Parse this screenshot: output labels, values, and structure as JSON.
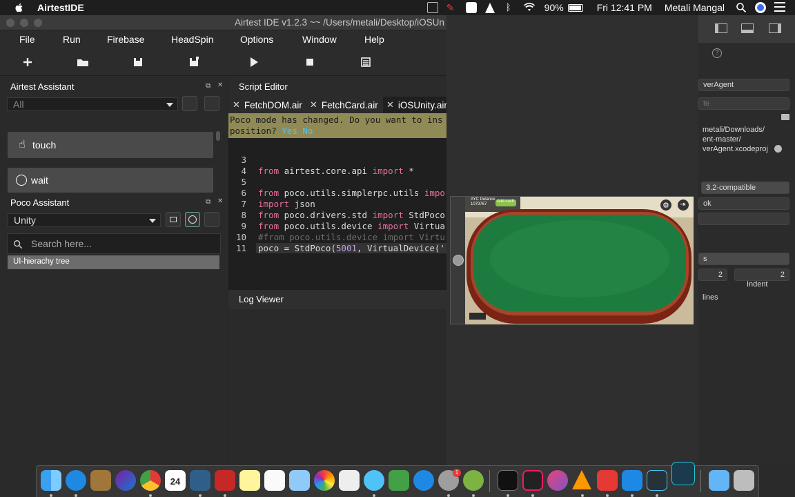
{
  "menubar": {
    "app_name": "AirtestIDE",
    "battery": "90%",
    "clock": "Fri 12:41 PM",
    "user": "Metali Mangal"
  },
  "window": {
    "title": "Airtest IDE v1.2.3 ~~ /Users/metali/Desktop/iOSUn"
  },
  "app_menu": {
    "items": [
      "File",
      "Run",
      "Firebase",
      "HeadSpin",
      "Options",
      "Window",
      "Help"
    ]
  },
  "airtest_assistant": {
    "title": "Airtest Assistant",
    "filter_value": "All",
    "actions": [
      "touch",
      "wait"
    ]
  },
  "poco_assistant": {
    "title": "Poco Assistant",
    "mode_value": "Unity",
    "search_placeholder": "Search here...",
    "tree_root": "UI-hierachy tree"
  },
  "script_editor": {
    "title": "Script Editor",
    "tabs": [
      "FetchDOM.air",
      "FetchCard.air",
      "iOSUnity.air"
    ],
    "notice_line1": "Poco mode has changed. Do you want to ins",
    "notice_line2": "position?",
    "notice_yes": "Yes",
    "notice_no": "No",
    "line_numbers": [
      "3",
      "4",
      "5",
      "6",
      "7",
      "8",
      "9",
      "10",
      "11"
    ],
    "lines": [
      {
        "kw1": "from",
        "mod": "airtest.core.api",
        "kw2": "import",
        "rest": "*"
      },
      {
        "kw1": "from",
        "mod": "poco.utils.simplerpc.utils",
        "kw2": "impo",
        "rest": ""
      },
      {
        "kw1": "import",
        "rest": "json"
      },
      {
        "kw1": "from",
        "mod": "poco.drivers.std",
        "kw2": "import",
        "rest": "StdPoco"
      },
      {
        "kw1": "from",
        "mod": "poco.utils.device",
        "kw2": "import",
        "rest": "Virtua"
      },
      {
        "comment": "#from poco.utils.device import Virtu"
      },
      {
        "pre": "poco = StdPoco(",
        "num": "5001",
        "post": ", VirtualDevice('"
      }
    ]
  },
  "log_viewer": {
    "title": "Log Viewer"
  },
  "right_panel": {
    "f1": "verAgent",
    "f2": "te",
    "path1": "metali/Downloads/",
    "path2": "ent-master/",
    "path3": "verAgent.xcodeproj",
    "compat": "3.2-compatible",
    "f3": "ok",
    "f4": "s",
    "tab_value": "2",
    "indent_value": "2",
    "indent_label": "Indent",
    "lines_label": "lines"
  },
  "game_hud": {
    "name": "AYC Delance",
    "chips": "1079767",
    "button": "Add cash"
  },
  "colors": {
    "notice_bg": "#908a56",
    "keyword": "#e66f9e",
    "module": "#9bd16c",
    "felt": "#1d7a3e",
    "rail": "#8a2a1a"
  },
  "dock": {
    "badges": {
      "app_store_updates": "1"
    },
    "calendar_day": "24"
  }
}
